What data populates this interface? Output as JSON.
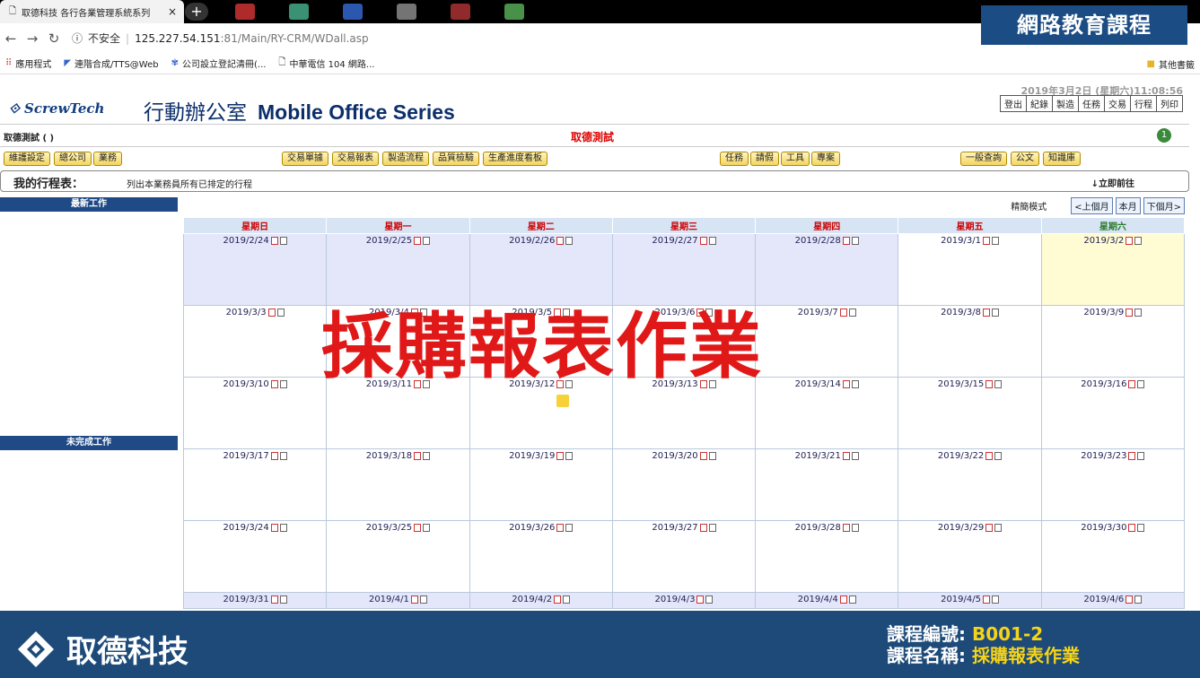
{
  "browser": {
    "tab_title": "取德科技 各行各業管理系統系列",
    "tab_close": "×",
    "new_tab": "+",
    "insecure_label": "不安全",
    "url_host": "125.227.54.151",
    "url_path": ":81/Main/RY-CRM/WDall.asp",
    "bookmarks": [
      "應用程式",
      "連階合成/TTS@Web",
      "公司設立登記清冊(...",
      "中華電信 104 網路..."
    ],
    "other_bookmarks": "其他書籤"
  },
  "overlay_title": "網路教育課程",
  "header": {
    "logo": "ScrewTech",
    "brand_zh": "行動辦公室",
    "brand_en": "Mobile Office Series",
    "datetime": "2019年3月2日 (星期六)11:08:56",
    "menu": [
      "登出",
      "紀錄",
      "製造",
      "任務",
      "交易",
      "行程",
      "列印"
    ]
  },
  "userbar": {
    "user": "取德測試 ( )",
    "company": "取德測試",
    "notif_count": "1"
  },
  "nav": {
    "left": [
      "維護設定",
      "總公司",
      "業務"
    ],
    "middle": [
      "交易單據",
      "交易報表",
      "製造流程",
      "品質檢驗",
      "生產進度看板"
    ],
    "right": [
      "任務",
      "請假",
      "工具",
      "專案"
    ],
    "far": [
      "一般查詢",
      "公文",
      "知識庫"
    ]
  },
  "schedule": {
    "title": "我的行程表：",
    "desc": "列出本業務員所有已排定的行程",
    "goto": "↓立即前往"
  },
  "left": {
    "latest": "最新工作",
    "pending": "未完成工作"
  },
  "calendar": {
    "mode": "精簡模式",
    "prev": "<上個月",
    "this": "本月",
    "next": "下個月>",
    "weekdays": [
      "星期日",
      "星期一",
      "星期二",
      "星期三",
      "星期四",
      "星期五",
      "星期六"
    ],
    "weeks": [
      [
        "2019/2/24",
        "2019/2/25",
        "2019/2/26",
        "2019/2/27",
        "2019/2/28",
        "2019/3/1",
        "2019/3/2"
      ],
      [
        "2019/3/3",
        "2019/3/4",
        "2019/3/5",
        "2019/3/6",
        "2019/3/7",
        "2019/3/8",
        "2019/3/9"
      ],
      [
        "2019/3/10",
        "2019/3/11",
        "2019/3/12",
        "2019/3/13",
        "2019/3/14",
        "2019/3/15",
        "2019/3/16"
      ],
      [
        "2019/3/17",
        "2019/3/18",
        "2019/3/19",
        "2019/3/20",
        "2019/3/21",
        "2019/3/22",
        "2019/3/23"
      ],
      [
        "2019/3/24",
        "2019/3/25",
        "2019/3/26",
        "2019/3/27",
        "2019/3/28",
        "2019/3/29",
        "2019/3/30"
      ],
      [
        "2019/3/31",
        "2019/4/1",
        "2019/4/2",
        "2019/4/3",
        "2019/4/4",
        "2019/4/5",
        "2019/4/6"
      ]
    ]
  },
  "watermark": "採購報表作業",
  "footer": {
    "company": "取德科技",
    "course_no_label": "課程編號:",
    "course_no": "B001-2",
    "course_name_label": "課程名稱:",
    "course_name": "採購報表作業"
  },
  "colors": {
    "navy": "#1d4a78",
    "red": "#e01818",
    "yellow": "#f5d31a"
  }
}
